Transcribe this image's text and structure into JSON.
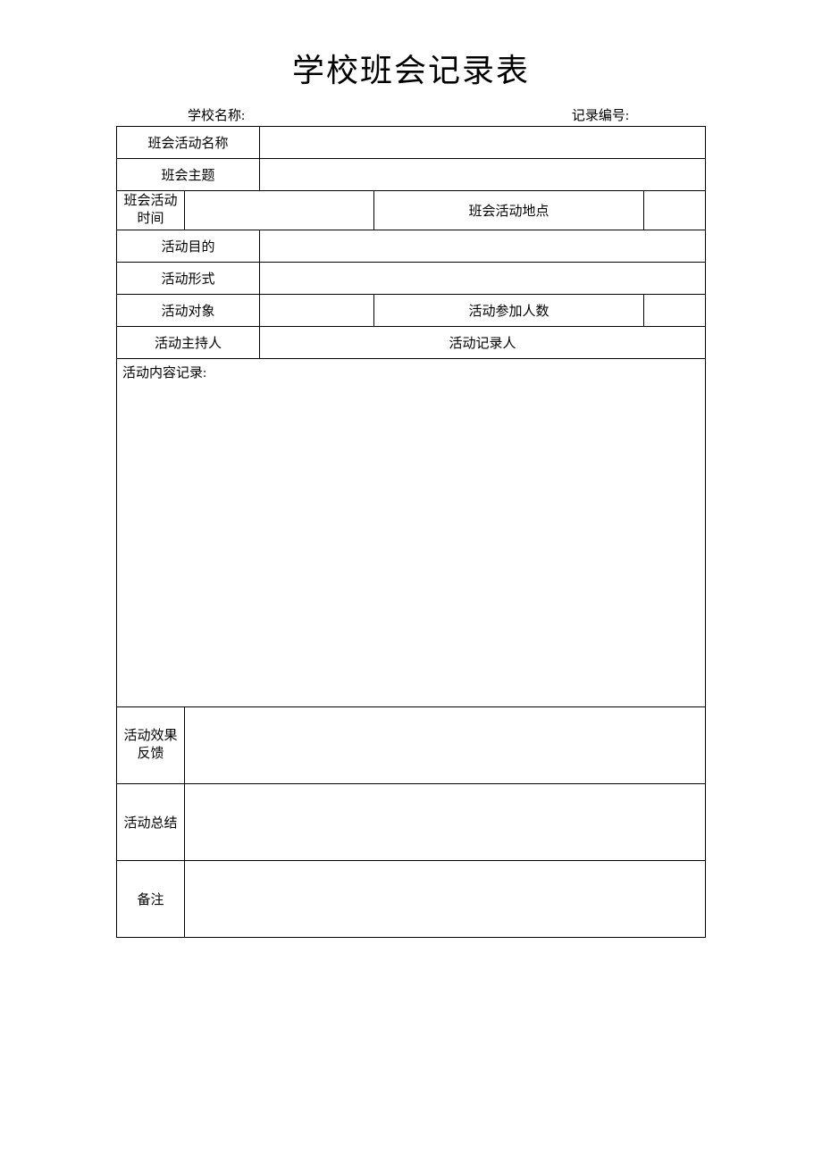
{
  "title": "学校班会记录表",
  "header": {
    "school_name_label": "学校名称:",
    "record_number_label": "记录编号:"
  },
  "labels": {
    "activity_name": "班会活动名称",
    "theme": "班会主题",
    "activity_time_line1": "班会活动",
    "activity_time_line2": "时间",
    "activity_location": "班会活动地点",
    "activity_purpose": "活动目的",
    "activity_form": "活动形式",
    "activity_target": "活动对象",
    "participant_count": "活动参加人数",
    "host": "活动主持人",
    "recorder": "活动记录人",
    "content_record": "活动内容记录:",
    "effect_feedback_line1": "活动效果",
    "effect_feedback_line2": "反馈",
    "summary": "活动总结",
    "remarks": "备注"
  },
  "values": {
    "activity_name": "",
    "theme": "",
    "activity_time": "",
    "activity_location": "",
    "activity_purpose": "",
    "activity_form": "",
    "activity_target": "",
    "participant_count": "",
    "host": "",
    "recorder": "",
    "content_record": "",
    "effect_feedback": "",
    "summary": "",
    "remarks": ""
  }
}
